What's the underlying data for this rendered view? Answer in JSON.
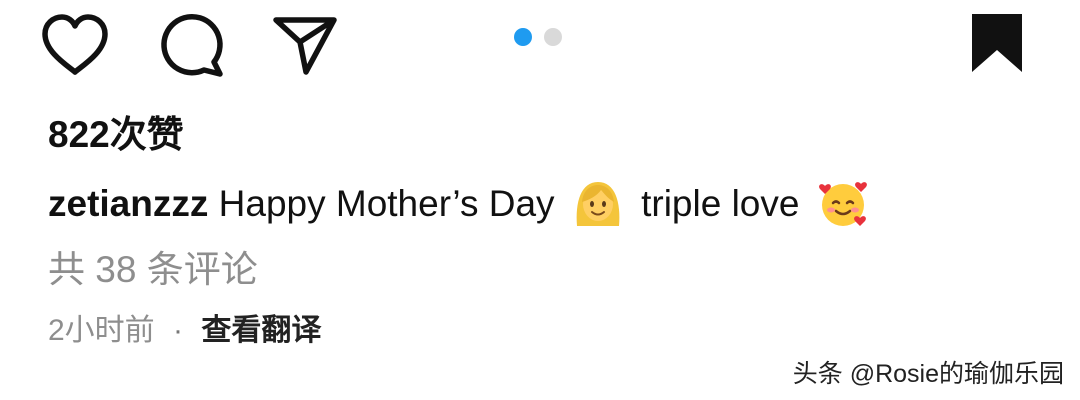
{
  "actions": {
    "icons": [
      "heart-icon",
      "comment-bubble-icon",
      "send-paper-plane-icon",
      "bookmark-icon"
    ],
    "pager": {
      "current": 1,
      "total": 2,
      "active_color": "#1f9bf0",
      "inactive_color": "#d9d9d9"
    }
  },
  "post": {
    "likes": "822次赞",
    "username": "zetianzzz",
    "caption_part1": "Happy Mother’s Day",
    "caption_part2": "triple love",
    "emojis": [
      "woman-blond-emoji",
      "smiling-face-with-hearts-emoji"
    ],
    "comments_link": "共 38 条评论",
    "time_ago": "2小时前",
    "separator": "·",
    "translate_link": "查看翻译"
  },
  "watermark": "头条 @Rosie的瑜伽乐园"
}
